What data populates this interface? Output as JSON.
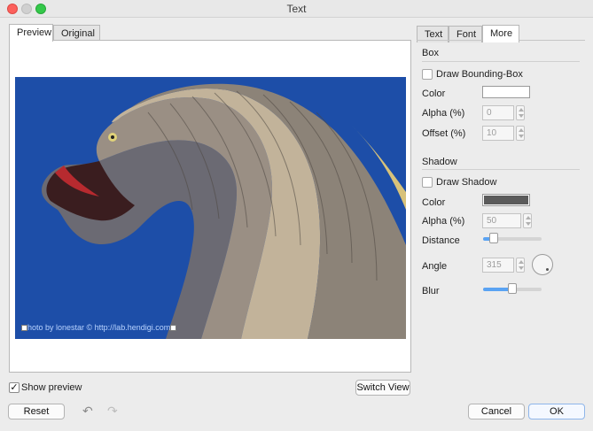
{
  "window": {
    "title": "Text"
  },
  "left_tabs": [
    {
      "label": "Preview",
      "active": true
    },
    {
      "label": "Original",
      "active": false
    }
  ],
  "preview": {
    "watermark": "hoto by lonestar © http://lab.hendigi.com"
  },
  "right_tabs": [
    {
      "label": "Text",
      "active": false
    },
    {
      "label": "Font",
      "active": false
    },
    {
      "label": "More",
      "active": true
    }
  ],
  "box": {
    "header": "Box",
    "draw_label": "Draw Bounding-Box",
    "draw_checked": false,
    "color_label": "Color",
    "color_value": "#ffffff",
    "alpha_label": "Alpha (%)",
    "alpha_value": "0",
    "offset_label": "Offset (%)",
    "offset_value": "10"
  },
  "shadow": {
    "header": "Shadow",
    "draw_label": "Draw Shadow",
    "draw_checked": false,
    "color_label": "Color",
    "color_value": "#5a5a5a",
    "alpha_label": "Alpha (%)",
    "alpha_value": "50",
    "distance_label": "Distance",
    "distance_level": 0.18,
    "angle_label": "Angle",
    "angle_value": "315",
    "blur_label": "Blur",
    "blur_level": 0.5
  },
  "footer": {
    "show_preview_label": "Show preview",
    "show_preview_checked": true,
    "switch_view_label": "Switch View",
    "reset_label": "Reset",
    "cancel_label": "Cancel",
    "ok_label": "OK",
    "undo_icon": "undo-arrow-icon",
    "redo_icon": "redo-arrow-icon"
  },
  "colors": {
    "sky": "#1d4ea8",
    "accent": "#5aa3f3"
  }
}
